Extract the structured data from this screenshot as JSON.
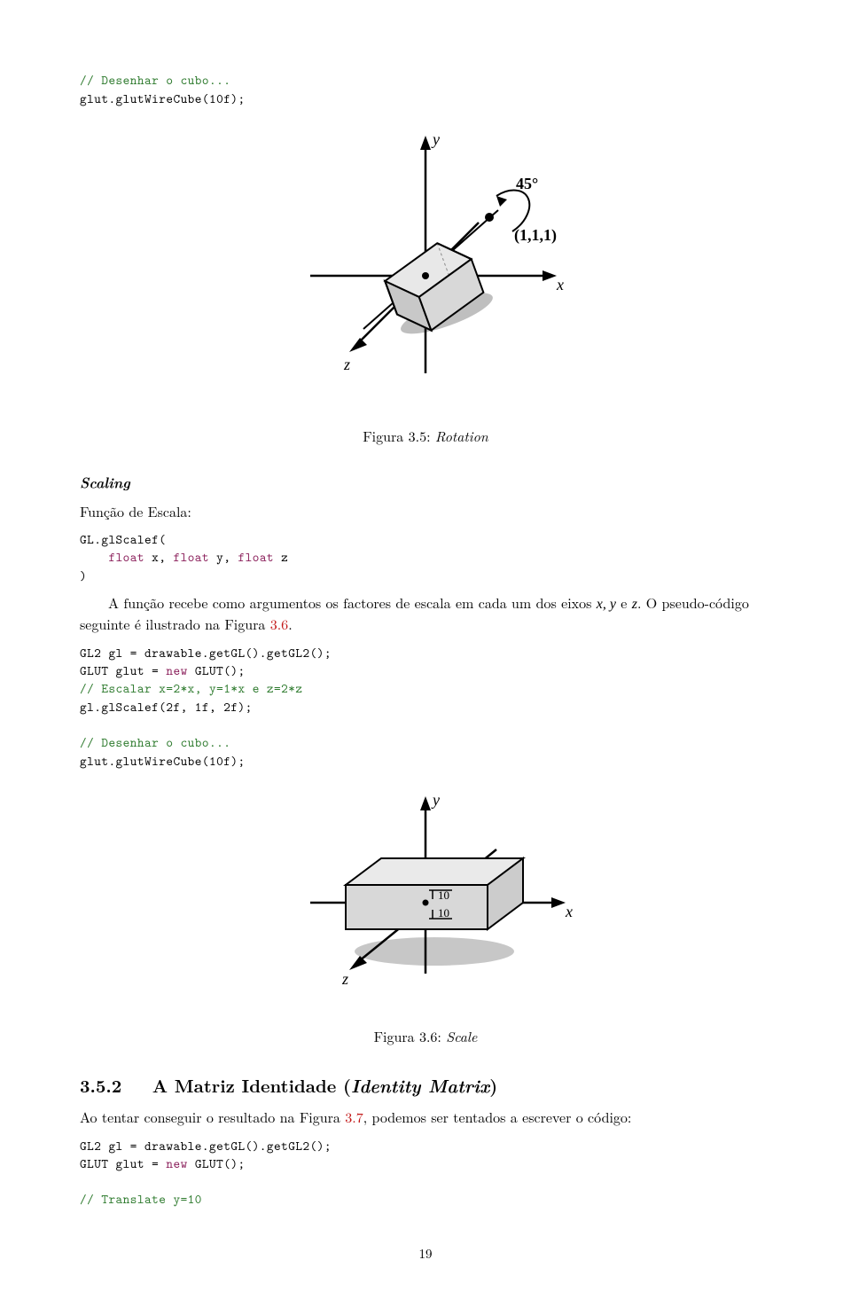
{
  "code1": {
    "c1": "// Desenhar o cubo...",
    "l1": "glut.glutWireCube(10f);"
  },
  "fig35": {
    "label": "Figura 3.5:",
    "name": "Rotation"
  },
  "scaling": {
    "heading": "Scaling",
    "intro": "Função de Escala:",
    "sig_l1a": "GL.glScalef(",
    "sig_l2a": "float",
    "sig_l2b": " x, ",
    "sig_l2c": "float",
    "sig_l2d": " y, ",
    "sig_l2e": "float",
    "sig_l2f": " z",
    "sig_l3": ")",
    "para_a": "A função recebe como argumentos os factores de escala em cada um dos eixos ",
    "para_vars": "x, y",
    "para_e": " e ",
    "para_z": "z",
    "para_b": ". O pseudo-código seguinte é ilustrado na Figura ",
    "para_ref": "3.6",
    "para_end": "."
  },
  "code2": {
    "l1": "GL2 gl = drawable.getGL().getGL2();",
    "l2a": "GLUT glut = ",
    "l2b": "new",
    "l2c": " GLUT();",
    "c1": "// Escalar x=2*x, y=1*x e z=2*z",
    "l3": "gl.glScalef(2f, 1f, 2f);",
    "c2": "// Desenhar o cubo...",
    "l4": "glut.glutWireCube(10f);"
  },
  "fig36": {
    "label": "Figura 3.6:",
    "name": "Scale"
  },
  "subsec": {
    "num": "3.5.2",
    "title_a": "A Matriz Identidade (",
    "title_b": "Identity Matrix",
    "title_c": ")",
    "para_a": "Ao tentar conseguir o resultado na Figura ",
    "ref": "3.7",
    "para_b": ", podemos ser tentados a escrever o código:"
  },
  "code3": {
    "l1": "GL2 gl = drawable.getGL().getGL2();",
    "l2a": "GLUT glut = ",
    "l2b": "new",
    "l2c": " GLUT();",
    "c1": "// Translate y=10"
  },
  "page": "19",
  "diagram35": {
    "y": "y",
    "x": "x",
    "z": "z",
    "angle": "45°",
    "coord": "(1,1,1)"
  },
  "diagram36": {
    "y": "y",
    "x": "x",
    "z": "z",
    "d1": "10",
    "d2": "10"
  }
}
